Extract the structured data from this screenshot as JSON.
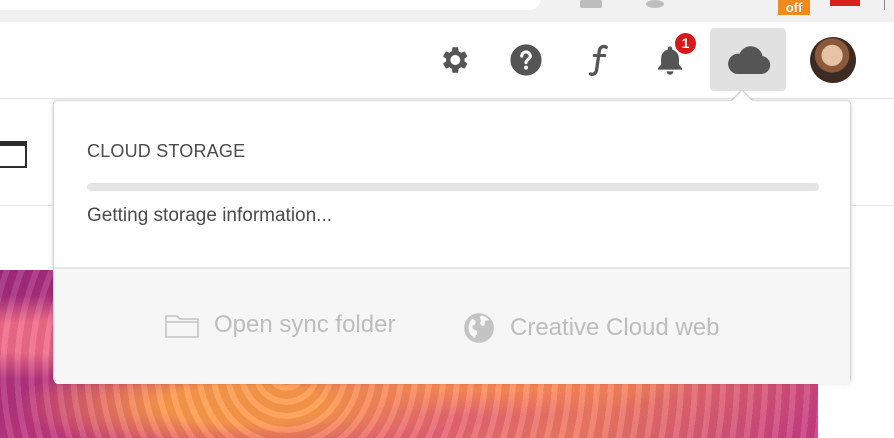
{
  "browser": {
    "extension_badge": "off"
  },
  "header": {
    "icons": [
      "gear-icon",
      "help-icon",
      "fonts-icon",
      "bell-icon",
      "cloud-icon"
    ],
    "notification_count": "1"
  },
  "popover": {
    "title": "CLOUD STORAGE",
    "status": "Getting storage information...",
    "progress_fraction": 0,
    "actions": {
      "open_sync_folder": "Open sync folder",
      "creative_cloud_web": "Creative Cloud web"
    }
  },
  "colors": {
    "icon": "#555555",
    "notification_badge": "#d7191c",
    "active_button_bg": "#e1e1e1",
    "disabled_text": "#bdbdbd"
  }
}
